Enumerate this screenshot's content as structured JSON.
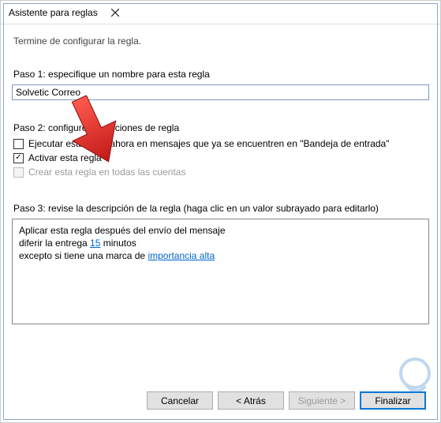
{
  "window": {
    "title": "Asistente para reglas",
    "subtitle": "Termine de configurar la regla."
  },
  "step1": {
    "label": "Paso 1: especifique un nombre para esta regla",
    "value": "Solvetic Correo"
  },
  "step2": {
    "label": "Paso 2: configure las opciones de regla",
    "options": [
      {
        "checked": false,
        "disabled": false,
        "label": "Ejecutar esta regla ahora en mensajes que ya se encuentren en \"Bandeja de entrada\""
      },
      {
        "checked": true,
        "disabled": false,
        "label": "Activar esta regla"
      },
      {
        "checked": false,
        "disabled": true,
        "label": "Crear esta regla en todas las cuentas"
      }
    ]
  },
  "step3": {
    "label": "Paso 3: revise la descripción de la regla (haga clic en un valor subrayado para editarlo)",
    "line1": "Aplicar esta regla después del envío del mensaje",
    "line2a": "diferir la entrega ",
    "line2_link": "15",
    "line2b": " minutos",
    "line3a": "excepto si tiene una marca de ",
    "line3_link": "importancia alta"
  },
  "buttons": {
    "cancel": "Cancelar",
    "back": "< Atrás",
    "next": "Siguiente >",
    "finish": "Finalizar"
  },
  "checkmark_glyph": "✓"
}
